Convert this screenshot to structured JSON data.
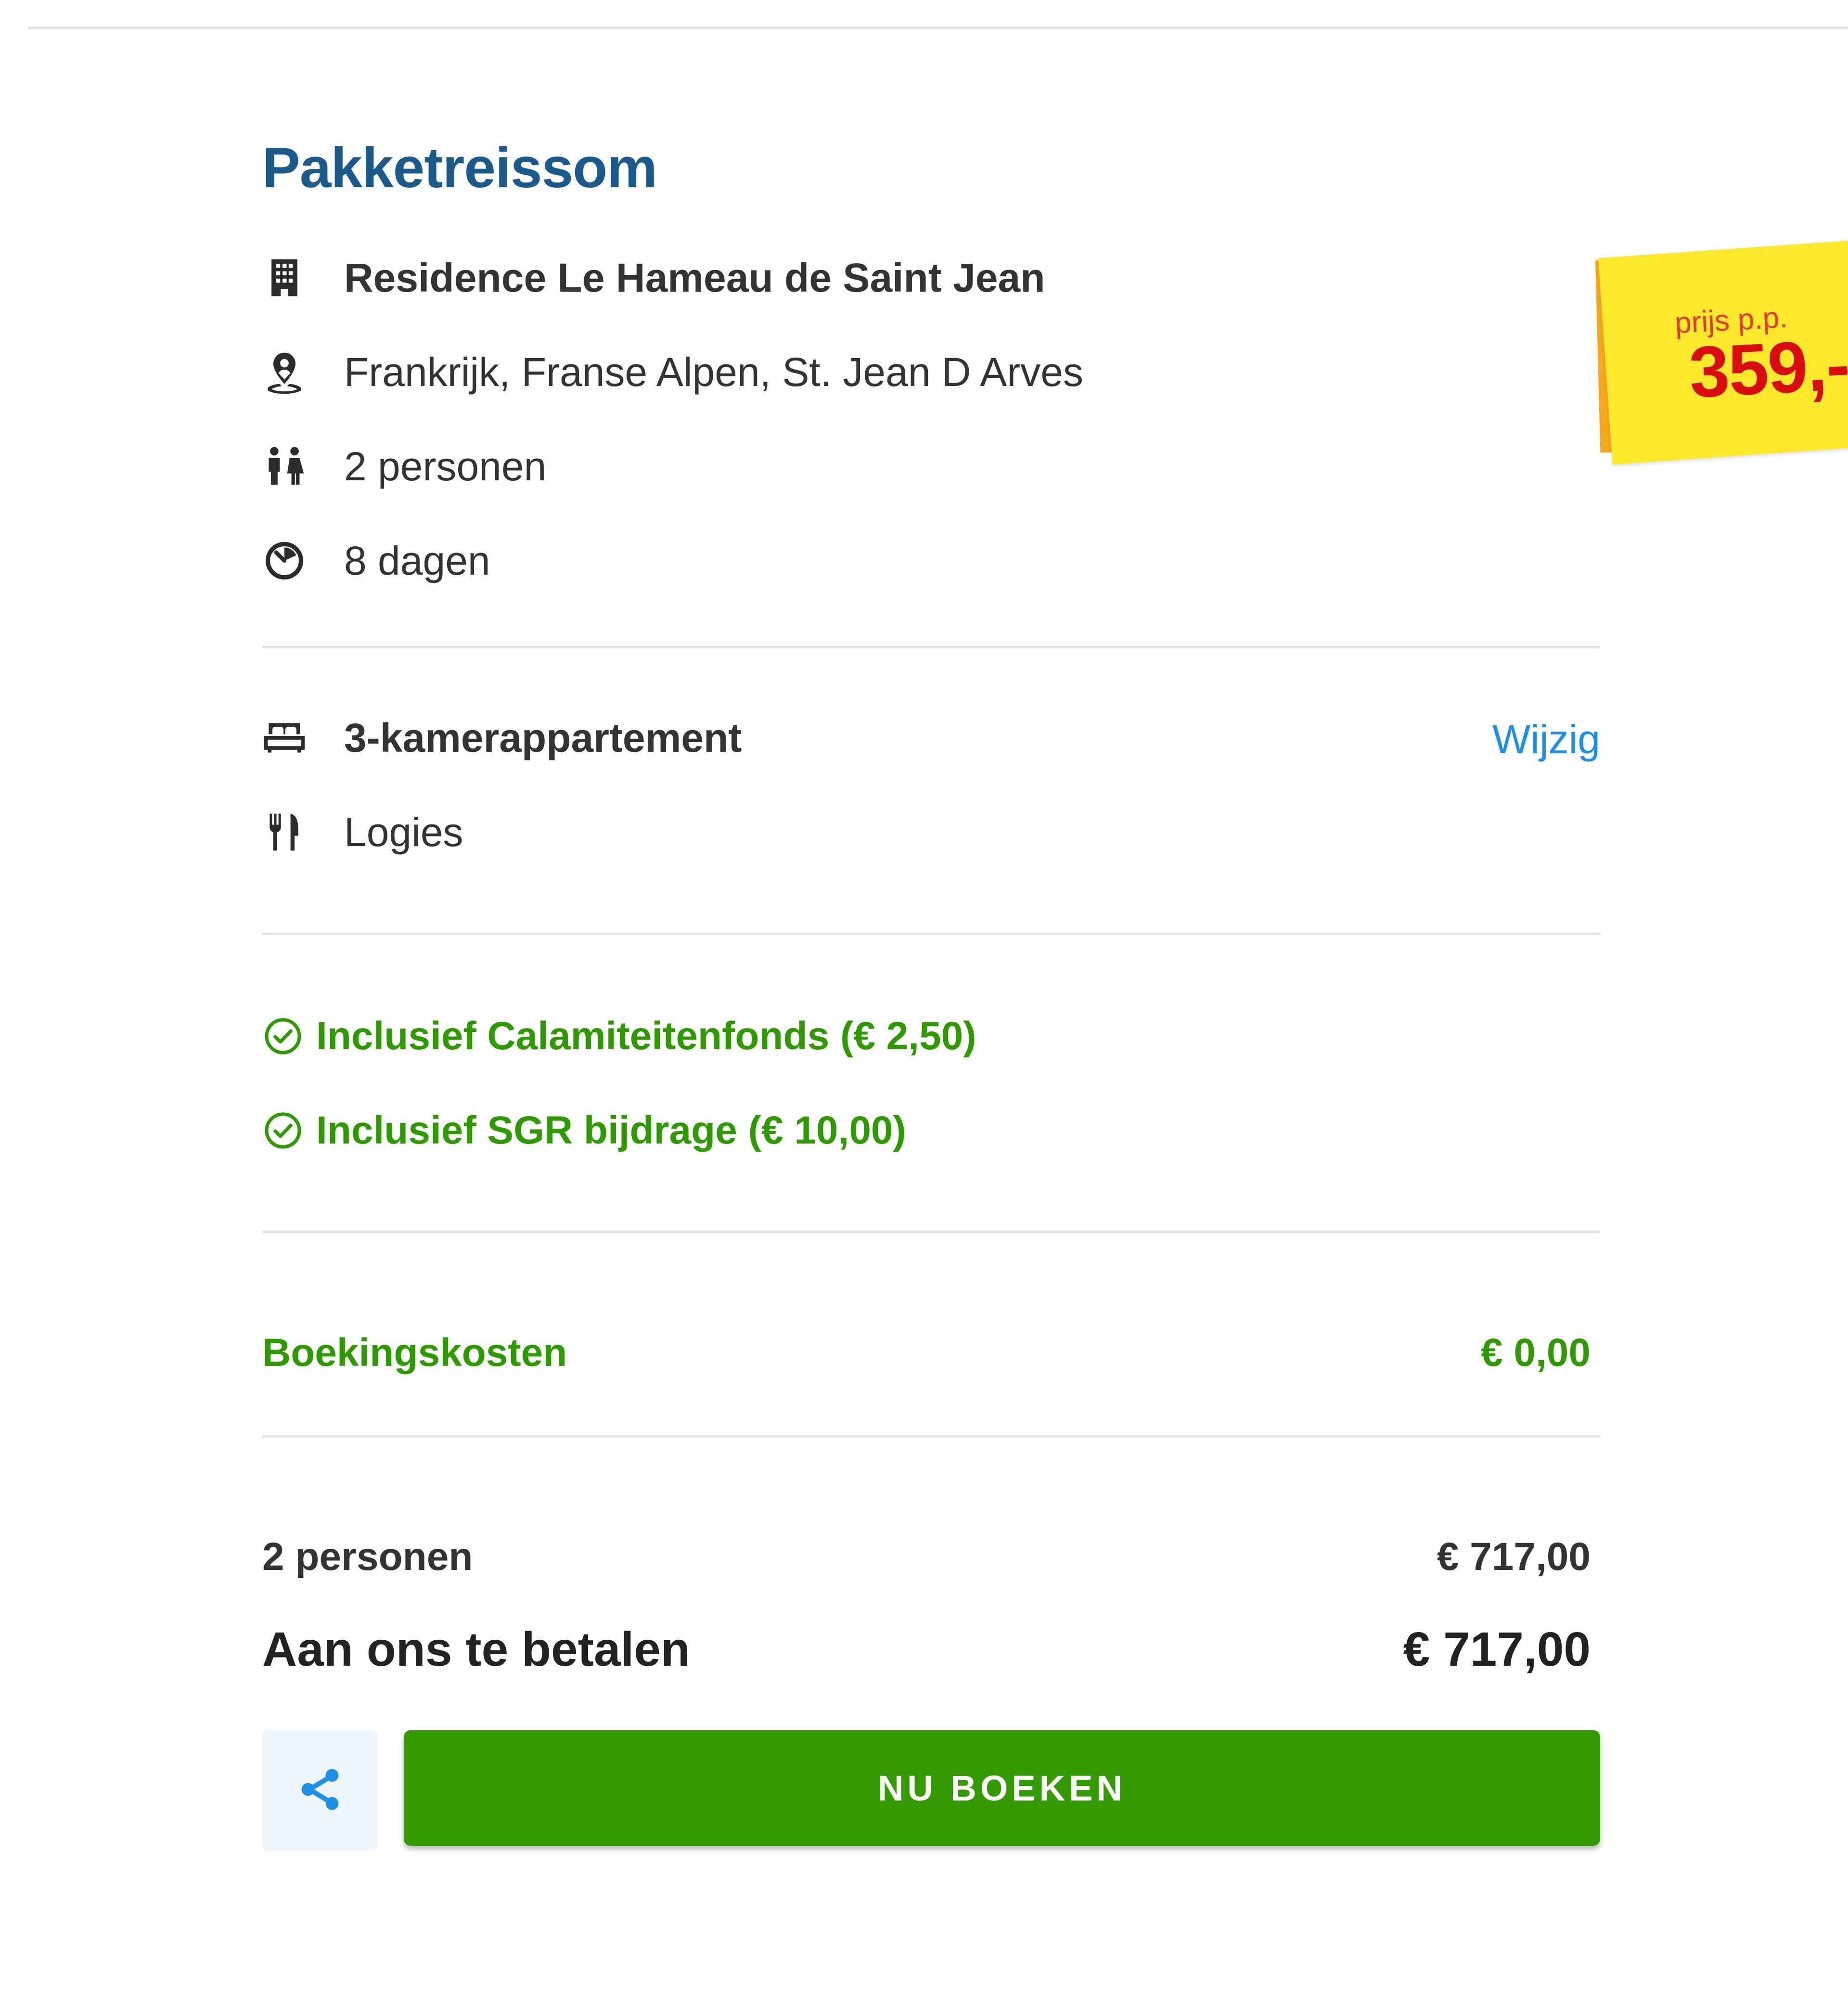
{
  "title": "Pakketreissom",
  "price_sticker": {
    "label": "prijs p.p.",
    "amount": "359,-"
  },
  "details": {
    "hotel": "Residence Le Hameau de Saint Jean",
    "location": "Frankrijk, Franse Alpen, St. Jean D Arves",
    "travelers": "2 personen",
    "duration": "8 dagen"
  },
  "room": {
    "type": "3-kamerappartement",
    "change_label": "Wijzig",
    "board": "Logies"
  },
  "inclusions": [
    "Inclusief Calamiteitenfonds (€ 2,50)",
    "Inclusief SGR bijdrage (€ 10,00)"
  ],
  "booking_costs": {
    "label": "Boekingskosten",
    "value": "€ 0,00"
  },
  "summary": {
    "persons_label": "2 personen",
    "persons_value": "€ 717,00",
    "total_label": "Aan ons te betalen",
    "total_value": "€ 717,00"
  },
  "actions": {
    "book_label": "NU BOEKEN"
  },
  "icons": {
    "hotel": "building-icon",
    "location": "map-pin-person-icon",
    "travelers": "people-icon",
    "duration": "timer-icon",
    "room": "bed-icon",
    "board": "fork-knife-icon",
    "inclusion": "check-circle-icon",
    "share": "share-icon"
  },
  "colors": {
    "title": "#1c5a8c",
    "green": "#2f9a00",
    "link": "#1f8fe6",
    "button": "#339b00",
    "sticker": "#fde92b",
    "price": "#d90d0d"
  }
}
